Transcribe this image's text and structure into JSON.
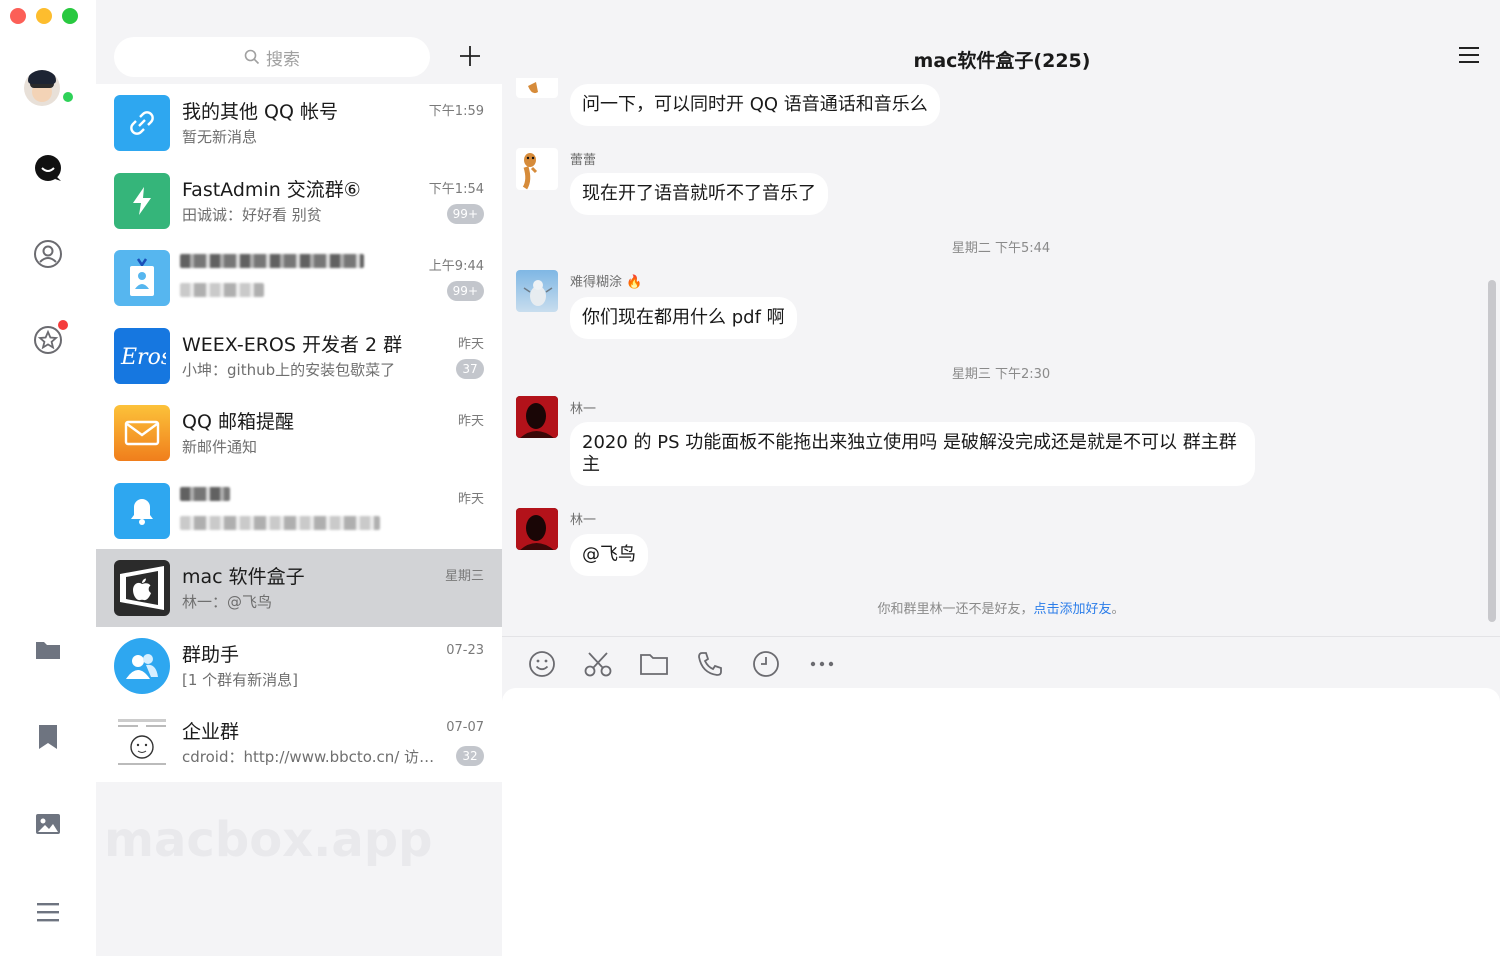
{
  "window": {
    "title": "mac软件盒子(225)"
  },
  "rail": {
    "icons": [
      "message-icon",
      "contacts-icon",
      "star-icon",
      "folder-icon",
      "bookmark-icon",
      "photo-icon",
      "menu-icon"
    ]
  },
  "search": {
    "placeholder": "搜索"
  },
  "conversations": [
    {
      "name": "我的其他 QQ 帐号",
      "snippet": "暂无新消息",
      "time": "下午1:59",
      "count": ""
    },
    {
      "name": "FastAdmin 交流群⑥",
      "snippet": "田诚诚：好好看 别贫",
      "time": "下午1:54",
      "count": "99+"
    },
    {
      "name": "",
      "snippet": "",
      "time": "上午9:44",
      "count": "99+"
    },
    {
      "name": "WEEX-EROS 开发者 2 群",
      "snippet": "小坤：github上的安装包歇菜了",
      "time": "昨天",
      "count": "37"
    },
    {
      "name": "QQ 邮箱提醒",
      "snippet": "新邮件通知",
      "time": "昨天",
      "count": ""
    },
    {
      "name": "",
      "snippet": "",
      "time": "昨天",
      "count": ""
    },
    {
      "name": "mac 软件盒子",
      "snippet": "林一：@飞鸟",
      "time": "星期三",
      "count": ""
    },
    {
      "name": "群助手",
      "snippet": "[1 个群有新消息]",
      "time": "07-23",
      "count": ""
    },
    {
      "name": "企业群",
      "snippet": "cdroid：http://www.bbcto.cn/ 访问...",
      "time": "07-07",
      "count": "32"
    }
  ],
  "watermark": "macbox.app",
  "chat": {
    "messages": [
      {
        "sender": "",
        "text": "问一下，可以同时开 QQ 语音通话和音乐么"
      },
      {
        "sender": "蕾蕾",
        "text": "现在开了语音就听不了音乐了"
      },
      {
        "sender": "难得糊涂 🔥",
        "text": "你们现在都用什么 pdf 啊"
      },
      {
        "sender": "林一",
        "text": "2020 的 PS 功能面板不能拖出来独立使用吗 是破解没完成还是就是不可以 群主群主"
      },
      {
        "sender": "林一",
        "text": "@飞鸟"
      }
    ],
    "timestamps": [
      "星期二 下午5:44",
      "星期三 下午2:30"
    ],
    "notice_prefix": "你和群里林一还不是好友，",
    "notice_link": "点击添加好友",
    "notice_suffix": "。"
  },
  "toolbar": {
    "icons": [
      "emoji-icon",
      "scissors-icon",
      "folder-icon",
      "phone-icon",
      "clock-icon",
      "more-icon"
    ]
  },
  "colors": {
    "accent": "#2b7de9",
    "online": "#2ed158",
    "badge": "#f53b3b",
    "selected": "#d2d3d6"
  }
}
